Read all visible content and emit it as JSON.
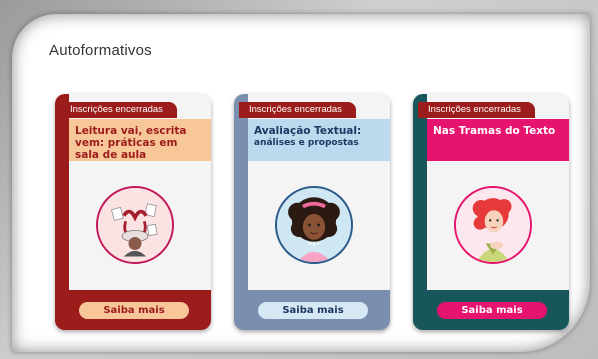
{
  "section": {
    "title": "Autoformativos"
  },
  "cards": [
    {
      "badge": "Inscrições encerradas",
      "title": "Leitura vai, escrita vem: práticas em sala de aula",
      "subtitle": "",
      "cta": "Saiba mais",
      "colors": {
        "primary": "#9c1b1b",
        "title_bg": "#f7c79a",
        "title_text": "#9c1b1b",
        "button_bg": "#f7c79a",
        "button_text": "#9c1b1b"
      },
      "icon": "book-reader-illustration"
    },
    {
      "badge": "Inscrições encerradas",
      "title": "Avaliação Textual:",
      "subtitle": "análises e propostas",
      "cta": "Saiba mais",
      "colors": {
        "primary": "#7a8fb0",
        "title_bg": "#bcd9ee",
        "title_text": "#1f3763",
        "button_bg": "#d6e8f3",
        "button_text": "#1f3763"
      },
      "icon": "girl-curly-hair-illustration"
    },
    {
      "badge": "Inscrições encerradas",
      "title": "Nas Tramas do Texto",
      "subtitle": "",
      "cta": "Saiba mais",
      "colors": {
        "primary": "#17575c",
        "title_bg": "#e6146e",
        "title_text": "#ffffff",
        "button_bg": "#e6146e",
        "button_text": "#ffffff"
      },
      "icon": "woman-red-hair-illustration"
    }
  ]
}
